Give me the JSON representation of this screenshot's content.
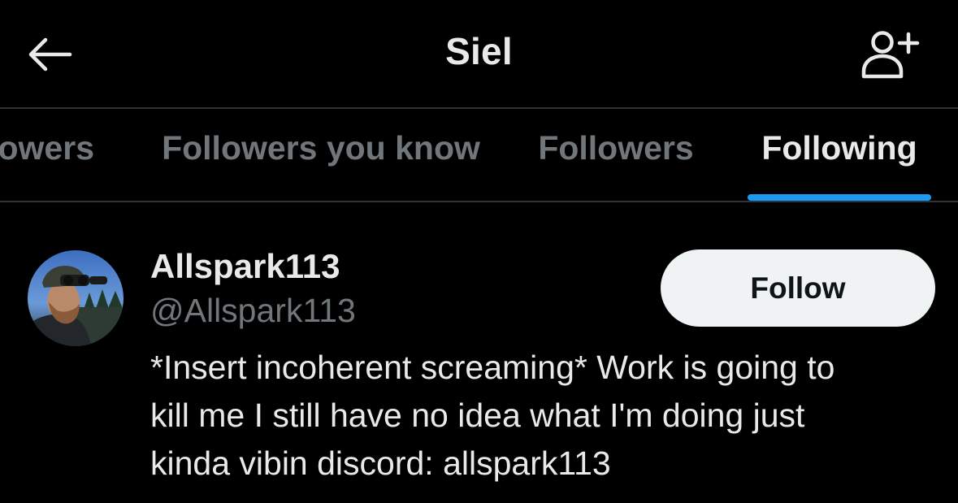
{
  "header": {
    "title": "Siel",
    "back_icon": "arrow-left-icon",
    "add_icon": "person-add-icon"
  },
  "tabs": [
    {
      "label": "owers",
      "active": false
    },
    {
      "label": "Followers you know",
      "active": false
    },
    {
      "label": "Followers",
      "active": false
    },
    {
      "label": "Following",
      "active": true
    }
  ],
  "user": {
    "display_name": "Allspark113",
    "handle": "@Allspark113",
    "follow_label": "Follow",
    "bio": "*Insert incoherent screaming* Work is going to\nkill me I still have no idea what I'm doing just\nkinda vibin discord: allspark113",
    "avatar_icon": "avatar-photo"
  },
  "colors": {
    "background": "#000000",
    "primary_text": "#e7e9ea",
    "secondary_text": "#71767b",
    "accent": "#1d9bf0",
    "divider": "#2f3336",
    "button_bg": "#eff3f4",
    "button_text": "#0f1419"
  }
}
